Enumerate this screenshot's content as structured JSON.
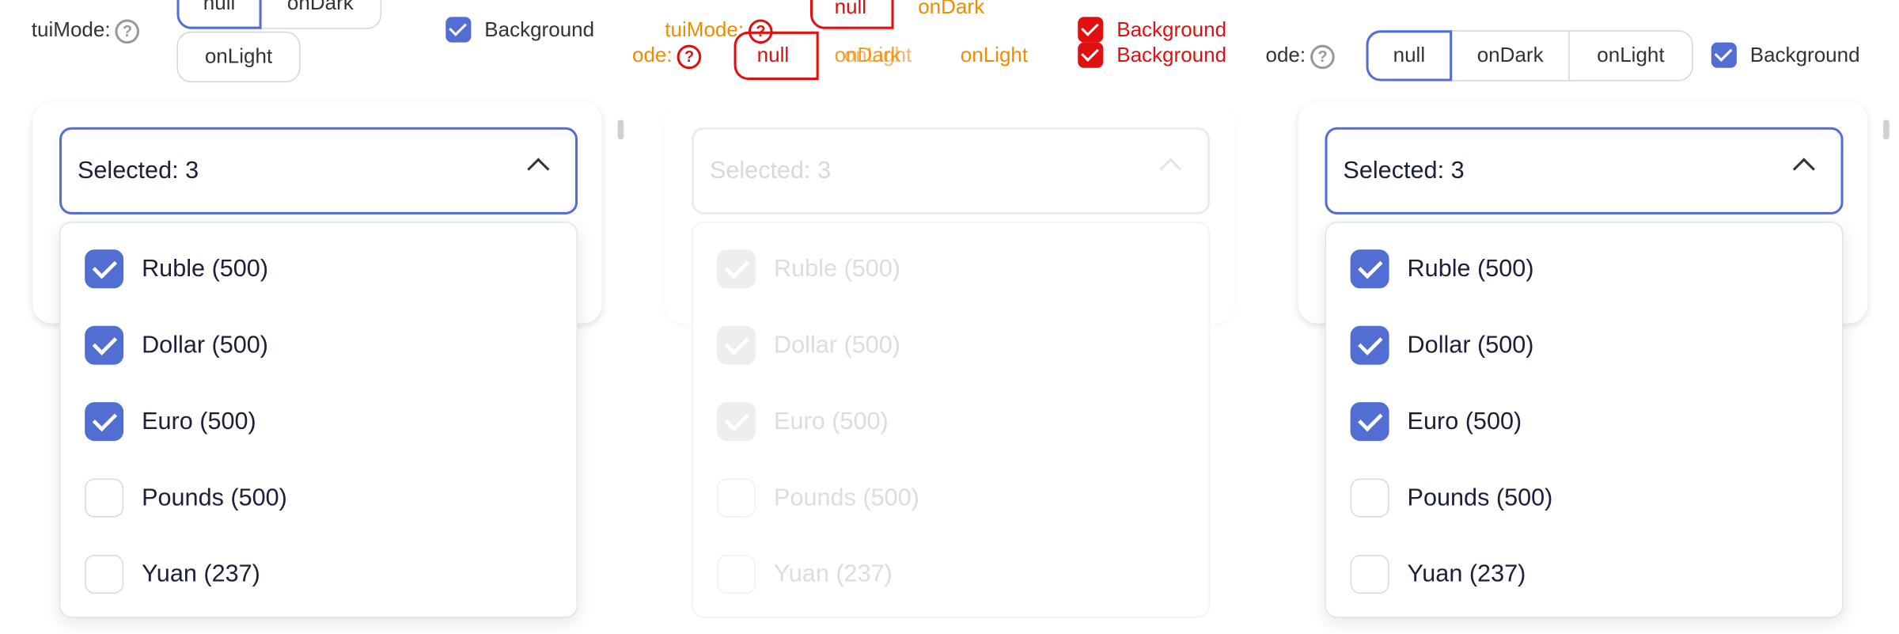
{
  "toolbar": {
    "mode_label": "tuiMode:",
    "mode_label_cut": "ode:",
    "help_glyph": "?",
    "modes": [
      "null",
      "onDark",
      "onLight"
    ],
    "background_label": "Background",
    "background_checked": true
  },
  "panel": {
    "select_value": "Selected: 3",
    "options": [
      {
        "label": "Ruble (500)",
        "checked": true
      },
      {
        "label": "Dollar (500)",
        "checked": true
      },
      {
        "label": "Euro (500)",
        "checked": true
      },
      {
        "label": "Pounds (500)",
        "checked": false
      },
      {
        "label": "Yuan (237)",
        "checked": false
      }
    ]
  },
  "colors": {
    "accent": "#526ed3",
    "overlay_orange": "#f08c00",
    "overlay_red": "#e01010"
  },
  "icons": [
    "help-icon",
    "checkbox-checked-icon",
    "chevron-up-icon"
  ]
}
